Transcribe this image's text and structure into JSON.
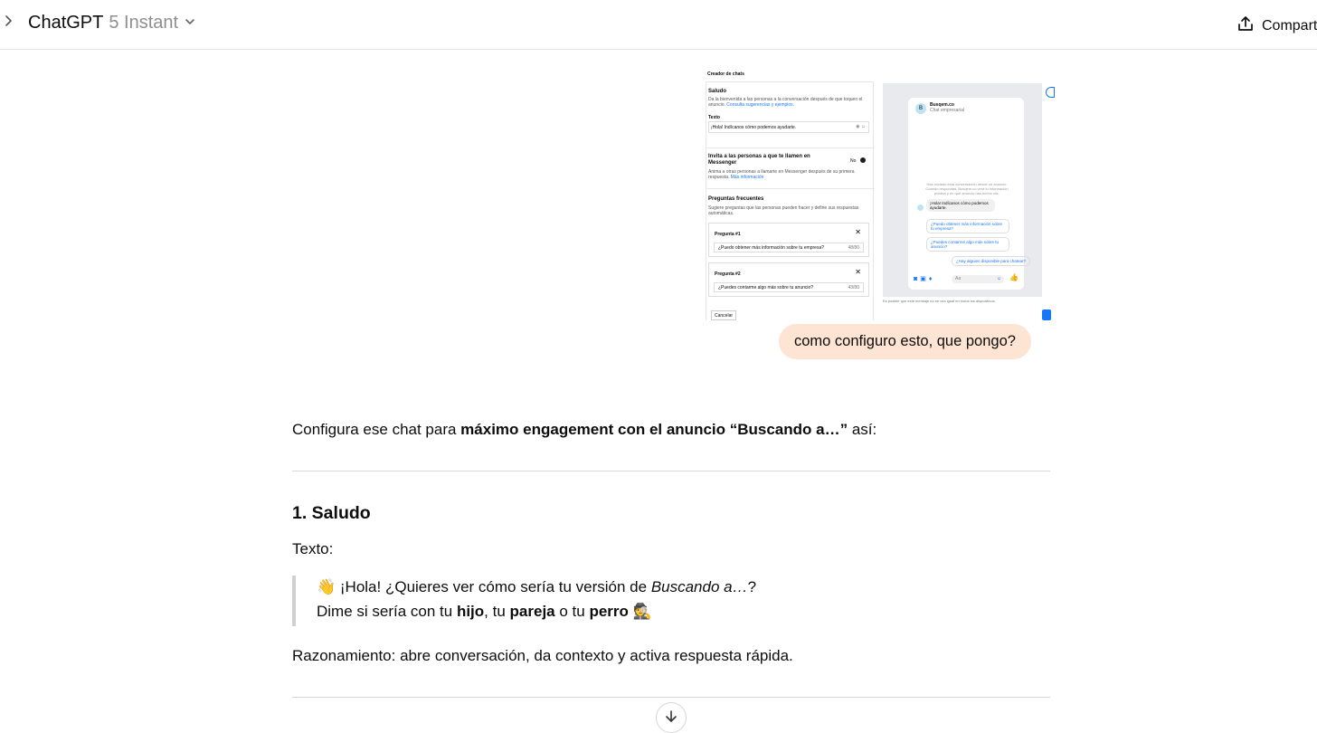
{
  "header": {
    "app_name": "ChatGPT",
    "model_version": "5 Instant",
    "share_label": "Compart"
  },
  "attachment": {
    "title": "Creador de chats",
    "greeting_title": "Saludo",
    "greeting_desc": "Da la bienvenida a las personas a la conversación después de que toquen el anuncio.",
    "greeting_link": "Consulta sugerencias y ejemplos.",
    "text_label": "Texto",
    "text_value": "¡Hola! Indícanos cómo podemos ayudarte.",
    "invite_title": "Invita a las personas a que te llamen en Messenger",
    "invite_toggle": "No",
    "invite_desc": "Anima a otras personas a llamarte en Messenger después de su primera respuesta.",
    "invite_link": "Más información",
    "faq_title": "Preguntas frecuentes",
    "faq_desc": "Sugiere preguntas que las personas pueden hacer y define sus respuestas automáticas.",
    "q1_label": "Pregunta #1",
    "q1_value": "¿Puedo obtener más información sobre tu empresa?",
    "q1_count": "48/80",
    "q2_label": "Pregunta #2",
    "q2_value": "¿Puedes contarme algo más sobre tu anuncio?",
    "q2_count": "43/80",
    "cancel": "Cancelar",
    "preview_name": "Busqem.co",
    "preview_sub": "Chat empresarial",
    "preview_notice": "Has iniciado esta conversación desde un anuncio. Cuando respondas, Busqem.co verá tu información pública y en qué anuncio has hecho clic.",
    "preview_msg": "¡Hola! Indícanos cómo podemos ayudarte.",
    "preview_q1": "¿Puedo obtener más información sobre tu empresa?",
    "preview_q2": "¿Puedes contarme algo más sobre tu anuncio?",
    "preview_q3": "¿Hay alguien disponible para chatear?",
    "preview_input": "Aa",
    "preview_footer": "Es posible que este mensaje no se vea igual en todos los dispositivos."
  },
  "user_message": "como configuro esto, que pongo?",
  "response": {
    "intro_pre": "Configura ese chat para ",
    "intro_bold": "máximo engagement con el anuncio “Buscando a…”",
    "intro_post": " así:",
    "section1_title": "1. Saludo",
    "text_label": "Texto:",
    "quote_line1_pre": "👋 ¡Hola! ¿Quieres ver cómo sería tu versión de ",
    "quote_line1_em": "Buscando a…",
    "quote_line1_post": "?",
    "quote_line2_pre": "Dime si sería con tu ",
    "quote_b1": "hijo",
    "quote_sep1": ", tu ",
    "quote_b2": "pareja",
    "quote_sep2": " o tu ",
    "quote_b3": "perro",
    "quote_emoji": " 🕵️",
    "reasoning": "Razonamiento: abre conversación, da contexto y activa respuesta rápida."
  }
}
